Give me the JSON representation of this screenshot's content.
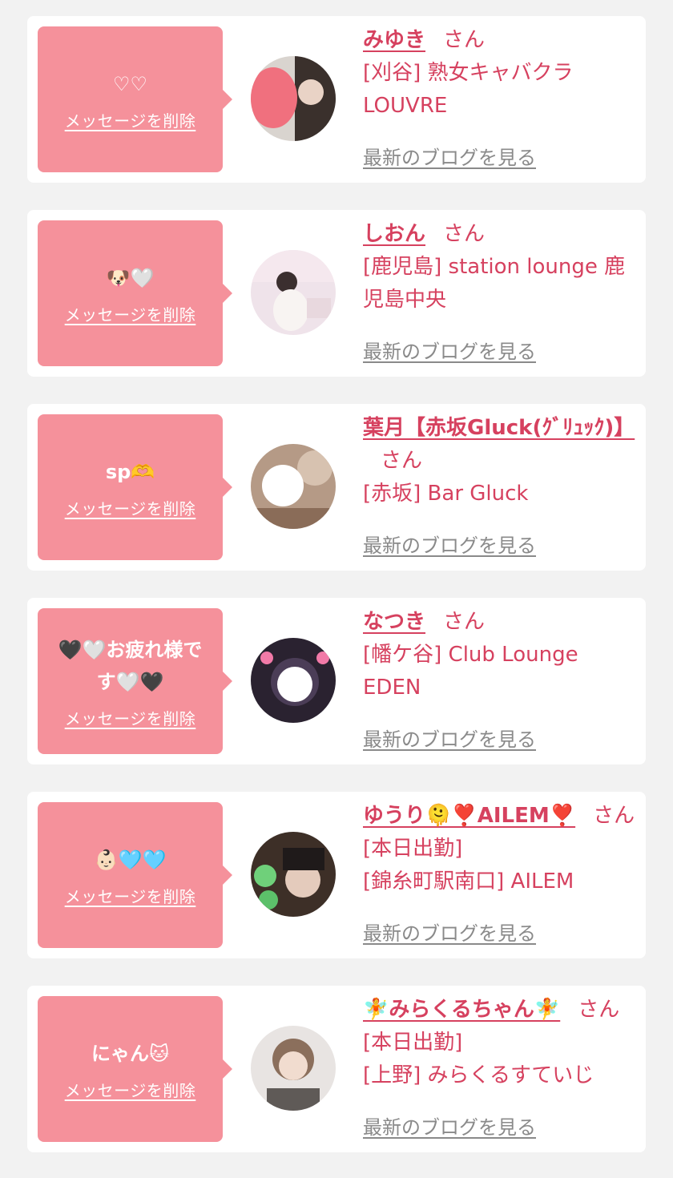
{
  "delete_label": "メッセージを削除",
  "blog_label": "最新のブログを見る",
  "san_label": "さん",
  "accent_color": "#d6415f",
  "bubble_color": "#f5919b",
  "items": [
    {
      "message": "♡♡",
      "name": "みゆき",
      "status": "",
      "shop": "[刈谷] 熟女キャバクラ LOUVRE"
    },
    {
      "message": "🐶🤍",
      "name": "しおん",
      "status": "",
      "shop": "[鹿児島] station lounge 鹿児島中央"
    },
    {
      "message": "sp🫶",
      "name": "葉月【赤坂Gluck(ｸﾞﾘｭｯｸ)】",
      "status": "",
      "shop": "[赤坂] Bar Gluck"
    },
    {
      "message": "🖤🤍お疲れ様です🤍🖤",
      "name": "なつき",
      "status": "",
      "shop": "[幡ケ谷] Club Lounge EDEN"
    },
    {
      "message": "👶🏻🩵🩵",
      "name": "ゆうり🫠❣️AILEM❣️",
      "status": "[本日出勤]",
      "shop": "[錦糸町駅南口] AILEM"
    },
    {
      "message": "にゃん🐱",
      "name": "🧚みらくるちゃん🧚",
      "status": "[本日出勤]",
      "shop": "[上野] みらくるすていじ"
    }
  ]
}
